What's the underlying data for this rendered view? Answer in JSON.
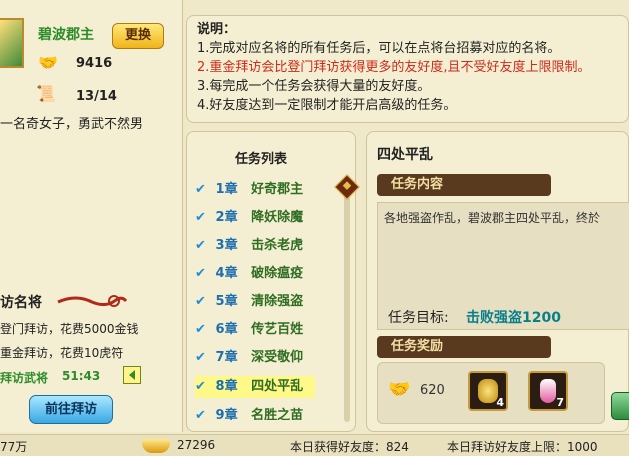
{
  "profile": {
    "name": "碧波郡主",
    "change_label": "更换",
    "favor_value": "9416",
    "quest_count": "13/14",
    "description": "一名奇女子，勇武不然男"
  },
  "visit": {
    "title": "访名将",
    "line1": "登门拜访，花费5000金钱",
    "line2": "重金拜访，花费10虎符",
    "timer_label": "拜访武将",
    "timer_value": "51:43",
    "go_label": "前往拜访"
  },
  "notice": {
    "title": "说明：",
    "lines": [
      "1.完成对应名将的所有任务后，可以在点将台招募对应的名将。",
      "2.重金拜访会比登门拜访获得更多的友好度,且不受好友度上限限制。",
      "3.每完成一个任务会获得大量的友好度。",
      "4.好友度达到一定限制才能开启高级的任务。"
    ]
  },
  "tasks": {
    "title": "任务列表",
    "items": [
      {
        "chapter": "1章",
        "name": "好奇郡主"
      },
      {
        "chapter": "2章",
        "name": "降妖除魔"
      },
      {
        "chapter": "3章",
        "name": "击杀老虎"
      },
      {
        "chapter": "4章",
        "name": "破除瘟疫"
      },
      {
        "chapter": "5章",
        "name": "清除强盗"
      },
      {
        "chapter": "6章",
        "name": "传艺百姓"
      },
      {
        "chapter": "7章",
        "name": "深受敬仰"
      },
      {
        "chapter": "8章",
        "name": "四处平乱"
      },
      {
        "chapter": "9章",
        "name": "名胜之苗"
      }
    ]
  },
  "detail": {
    "title": "四处平乱",
    "content_ribbon": "任务内容",
    "content_text": "各地强盗作乱，碧波郡主四处平乱，终於",
    "goal_label": "任务目标:",
    "goal_value": "击败强盗1200",
    "reward_ribbon": "任务奖励",
    "reward_favor": "620",
    "item1_count": "4",
    "item2_count": "7"
  },
  "footer": {
    "left_value": "77万",
    "gold_value": "27296",
    "today_favor": "本日获得好友度：824",
    "today_limit": "本日拜访好友度上限：1000"
  },
  "colors": {
    "highlight": "#fff98a",
    "red_text": "#d02a1a",
    "green_text": "#2f6d22",
    "ribbon_brown": "#5a3a1e"
  }
}
